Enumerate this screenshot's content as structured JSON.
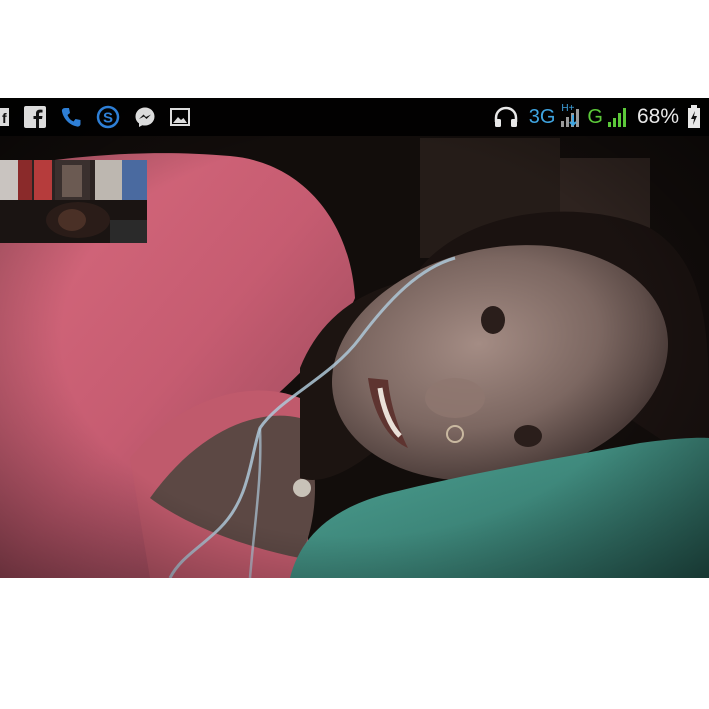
{
  "status_bar": {
    "left_icons": [
      "facebook-small-icon",
      "facebook-icon",
      "phone-icon",
      "skype-icon",
      "messenger-icon",
      "image-icon"
    ],
    "right": {
      "headphones_icon": "headphones-icon",
      "network_type": "3G",
      "network_superscript": "H+",
      "network_type_2": "G",
      "battery_percent": "68%",
      "battery_icon": "battery-charging-icon"
    },
    "colors": {
      "network_blue": "#3fa4e0",
      "network_green": "#5cc93a",
      "icon_blue": "#2e7fd6"
    }
  },
  "call": {
    "remote_video": "remote-participant-video",
    "self_view": "self-view-thumbnail"
  }
}
